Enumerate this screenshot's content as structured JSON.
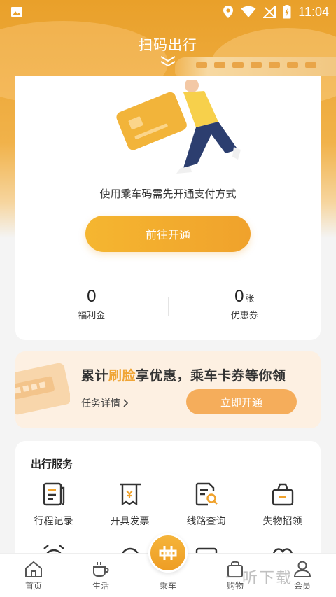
{
  "status_bar": {
    "time": "11:04"
  },
  "header": {
    "title": "扫码出行"
  },
  "main_card": {
    "pay_hint": "使用乘车码需先开通支付方式",
    "open_button": "前往开通",
    "stats": [
      {
        "value": "0",
        "unit": "",
        "label": "福利金"
      },
      {
        "value": "0",
        "unit": "张",
        "label": "优惠券"
      }
    ]
  },
  "promo": {
    "title_pre": "累计",
    "title_highlight": "刷脸",
    "title_post": "享优惠，乘车卡券等你领",
    "task_link": "任务详情",
    "claim_button": "立即开通"
  },
  "services": {
    "title": "出行服务",
    "items": [
      {
        "label": "行程记录",
        "icon": "trip-record-icon"
      },
      {
        "label": "开具发票",
        "icon": "invoice-icon"
      },
      {
        "label": "线路查询",
        "icon": "route-search-icon"
      },
      {
        "label": "失物招领",
        "icon": "lost-found-icon"
      }
    ]
  },
  "bottom_nav": {
    "items": [
      {
        "label": "首页",
        "icon": "home-icon"
      },
      {
        "label": "生活",
        "icon": "coffee-icon"
      },
      {
        "label": "乘车",
        "icon": "ride-icon"
      },
      {
        "label": "购物",
        "icon": "shopping-bag-icon"
      },
      {
        "label": "会员",
        "icon": "member-icon"
      }
    ]
  },
  "watermark": "一听下载",
  "colors": {
    "accent": "#f0a22c",
    "highlight": "#f0a536",
    "promo_bg": "#fdf0e2",
    "claim_button": "#f5ad5b"
  }
}
